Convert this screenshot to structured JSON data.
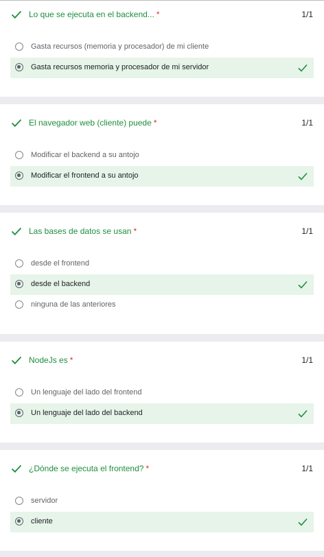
{
  "questions": [
    {
      "title": "Lo que se ejecuta en el backend...",
      "required_mark": "*",
      "score": "1/1",
      "options": [
        {
          "label": "Gasta recursos (memoria y procesador) de mi cliente",
          "selected": false
        },
        {
          "label": "Gasta recursos memoria y procesador de mi servidor",
          "selected": true
        }
      ]
    },
    {
      "title": "El navegador web (cliente) puede",
      "required_mark": "*",
      "score": "1/1",
      "options": [
        {
          "label": "Modificar el backend a su antojo",
          "selected": false
        },
        {
          "label": "Modificar el frontend a su antojo",
          "selected": true
        }
      ]
    },
    {
      "title": "Las bases de datos se usan",
      "required_mark": "*",
      "score": "1/1",
      "options": [
        {
          "label": "desde el frontend",
          "selected": false
        },
        {
          "label": "desde el backend",
          "selected": true
        },
        {
          "label": "ninguna de las anteriores",
          "selected": false
        }
      ]
    },
    {
      "title": "NodeJs es",
      "required_mark": "*",
      "score": "1/1",
      "options": [
        {
          "label": "Un lenguaje del lado del frontend",
          "selected": false
        },
        {
          "label": "Un lenguaje del lado del backend",
          "selected": true
        }
      ]
    },
    {
      "title": "¿Dónde se ejecuta el frontend?",
      "required_mark": "*",
      "score": "1/1",
      "options": [
        {
          "label": "servidor",
          "selected": false
        },
        {
          "label": "cliente",
          "selected": true
        }
      ]
    }
  ],
  "colors": {
    "correct": "#1e8e3e",
    "required": "#d93025",
    "selected_bg": "#e6f4ea",
    "page_bg": "#ebebf0"
  },
  "icons": {
    "question_status": "checkmark-icon",
    "option_correct": "checkmark-icon"
  }
}
